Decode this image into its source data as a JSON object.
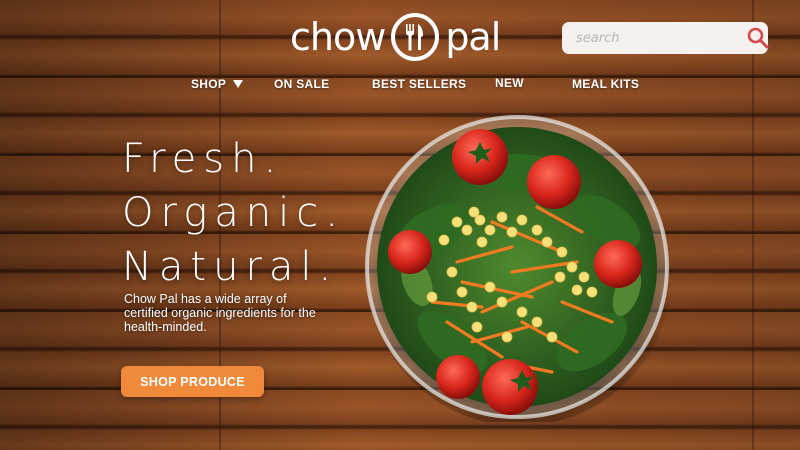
{
  "brand": {
    "logo_left": "chow",
    "logo_right": "pal",
    "icon": "fork-knife-icon"
  },
  "search": {
    "placeholder": "search",
    "value": "",
    "icon": "search-icon"
  },
  "nav": {
    "items": [
      {
        "label": "SHOP",
        "has_dropdown": true
      },
      {
        "label": "ON SALE"
      },
      {
        "label": "BEST SELLERS"
      },
      {
        "label": "NEW"
      },
      {
        "label": "MEAL KITS"
      }
    ]
  },
  "hero": {
    "headline": [
      "Fresh.",
      "Organic.",
      "Natural."
    ],
    "tagline": "Chow Pal has a wide array of certified organic ingredients for the health-minded.",
    "cta_label": "SHOP PRODUCE",
    "image": "salad-bowl-image"
  },
  "colors": {
    "accent": "#f08a3a",
    "search_icon": "#d8494a",
    "text": "#ffffff"
  }
}
